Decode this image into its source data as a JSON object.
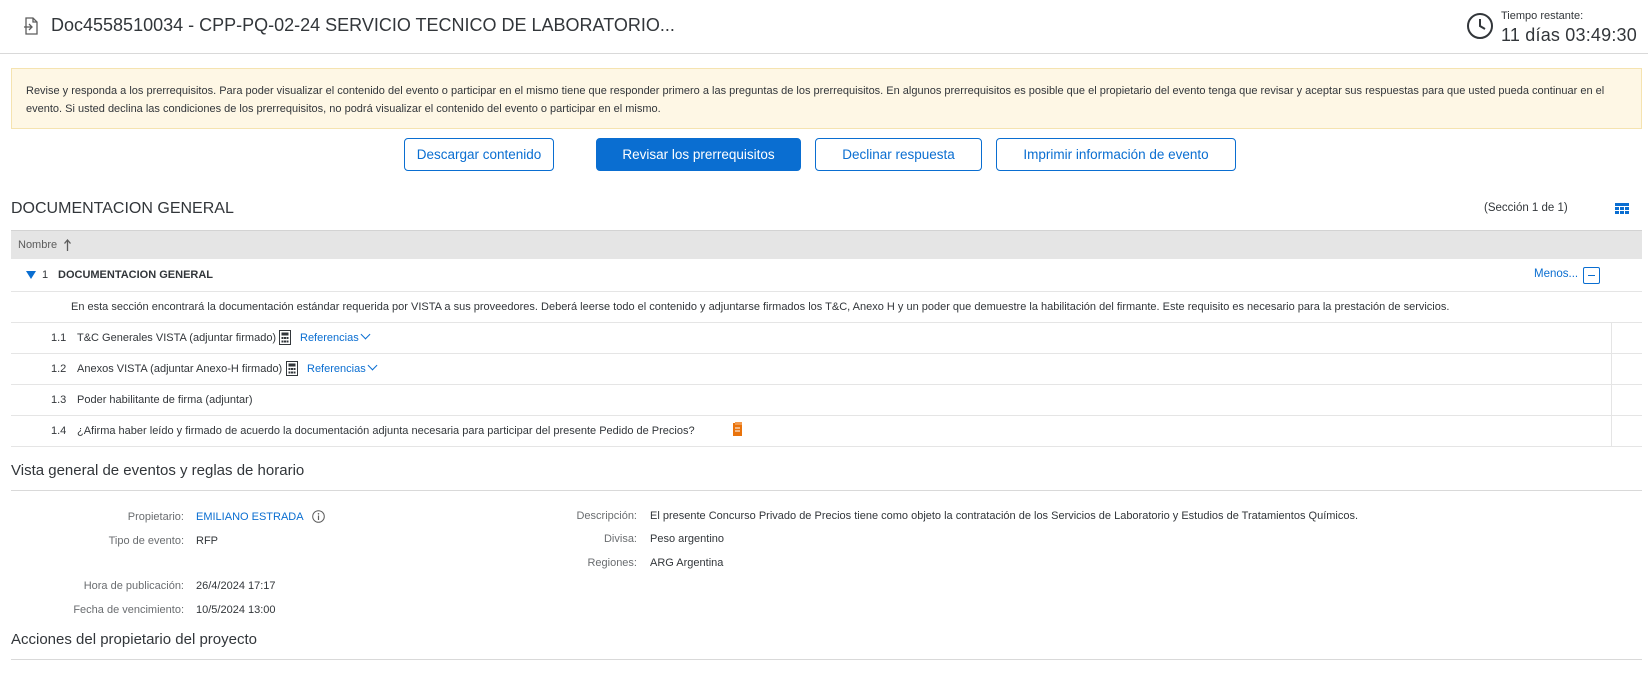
{
  "header": {
    "title": "Doc4558510034 - CPP-PQ-02-24 SERVICIO TECNICO DE LABORATORIO...",
    "time_label": "Tiempo restante:",
    "time_value": "11 días 03:49:30"
  },
  "banner": {
    "text": "Revise y responda a los prerrequisitos. Para poder visualizar el contenido del evento o participar en el mismo tiene que responder primero a las preguntas de los prerrequisitos. En algunos prerrequisitos es posible que el propietario del evento tenga que revisar y aceptar sus respuestas para que usted pueda continuar en el evento. Si usted declina las condiciones de los prerrequisitos, no podrá visualizar el contenido del evento o participar en el mismo."
  },
  "actions": {
    "download": "Descargar contenido",
    "review": "Revisar los prerrequisitos",
    "decline": "Declinar respuesta",
    "print": "Imprimir información de evento"
  },
  "section": {
    "title": "DOCUMENTACION GENERAL",
    "count": "(Sección 1 de 1)",
    "column_header": "Nombre",
    "group": {
      "num": "1",
      "name": "DOCUMENTACION GENERAL",
      "toggle_label": "Menos...",
      "description": "En esta sección encontrará la documentación estándar requerida por VISTA a sus proveedores. Deberá leerse todo el contenido y adjuntarse firmados los T&C, Anexo H y un poder que demuestre la habilitación del firmante. Este requisito es necesario para la prestación de servicios."
    },
    "items": [
      {
        "num": "1.1",
        "name": "T&C Generales VISTA (adjuntar firmado)",
        "ref": "Referencias"
      },
      {
        "num": "1.2",
        "name": "Anexos VISTA (adjuntar Anexo-H firmado)",
        "ref": "Referencias"
      },
      {
        "num": "1.3",
        "name": "Poder habilitante de firma (adjuntar)"
      },
      {
        "num": "1.4",
        "name": "¿Afirma haber leído y firmado de acuerdo la documentación adjunta necesaria para participar del presente Pedido de Precios?"
      }
    ]
  },
  "overview": {
    "title": "Vista general de eventos y reglas de horario",
    "owner_label": "Propietario:",
    "owner_value": "EMILIANO ESTRADA",
    "type_label": "Tipo de evento:",
    "type_value": "RFP",
    "pub_label": "Hora de publicación:",
    "pub_value": "26/4/2024 17:17",
    "due_label": "Fecha de vencimiento:",
    "due_value": "10/5/2024 13:00",
    "desc_label": "Descripción:",
    "desc_value": "El presente Concurso Privado de Precios tiene como objeto la contratación de los Servicios de Laboratorio y Estudios de Tratamientos Químicos.",
    "currency_label": "Divisa:",
    "currency_value": "Peso argentino",
    "regions_label": "Regiones:",
    "regions_value": "ARG Argentina"
  },
  "owner_actions": {
    "title": "Acciones del propietario del proyecto"
  },
  "icons": {
    "doc": "document-icon",
    "clock": "clock-icon",
    "grid": "table-settings-icon",
    "calc": "attachment-document-icon",
    "orange_doc": "required-document-icon",
    "info": "info-icon"
  },
  "colors": {
    "accent": "#0a6ed1",
    "banner_bg": "#fef7e5",
    "orange": "#e9730c"
  }
}
